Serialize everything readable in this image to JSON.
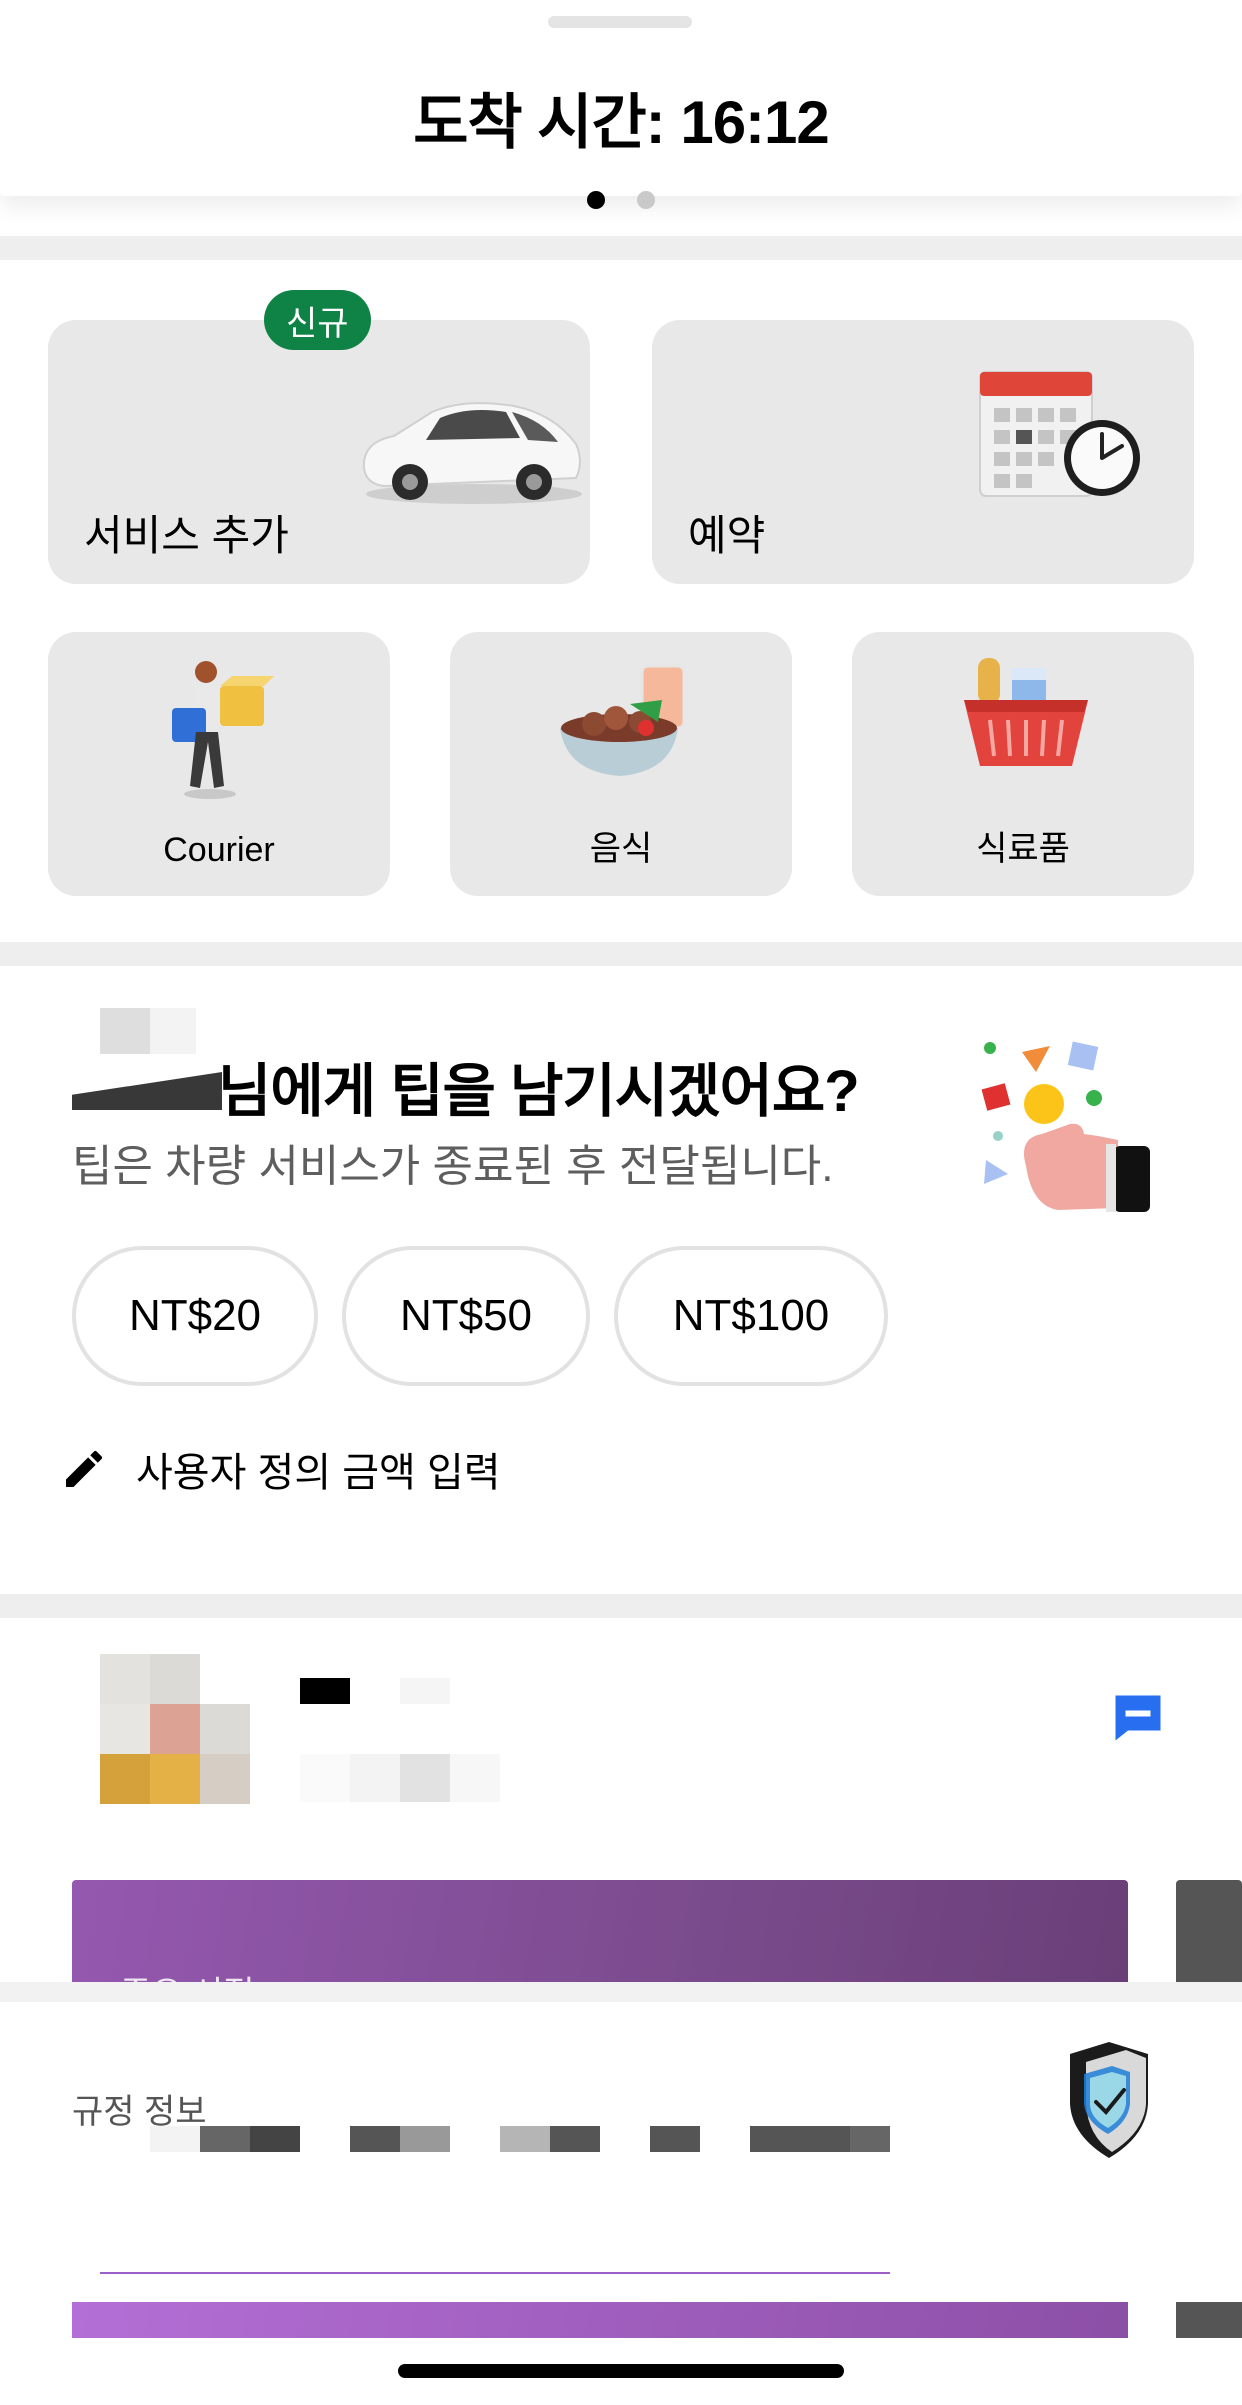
{
  "header": {
    "arrival_text": "도착 시간: 16:12"
  },
  "pager": {
    "pages": 2,
    "active": 0
  },
  "services": {
    "badge_new": "신규",
    "add_service": "서비스 추가",
    "reserve": "예약",
    "courier": "Courier",
    "food": "음식",
    "grocery": "식료품"
  },
  "tip": {
    "title": "님에게 팁을 남기시겠어요?",
    "subtitle": "팁은 차량 서비스가 종료된 후 전달됩니다.",
    "options": [
      "NT$20",
      "NT$50",
      "NT$100"
    ],
    "custom_label": "사용자 정의 금액 입력"
  },
  "driver": {
    "promo_text": "주요 시점"
  },
  "regulation": {
    "label": "규정 정보"
  },
  "colors": {
    "badge_green": "#0e8345",
    "chat_blue": "#276ef1",
    "promo_purple": "#8c4fa6"
  },
  "icons": {
    "add_service": "car-icon",
    "reserve": "calendar-clock-icon",
    "courier": "courier-person-icon",
    "food": "food-bowl-icon",
    "grocery": "grocery-basket-icon",
    "tip_illustration": "tip-hand-icon",
    "custom_amount": "pencil-icon",
    "chat": "chat-icon",
    "regulation": "shield-check-icon"
  }
}
